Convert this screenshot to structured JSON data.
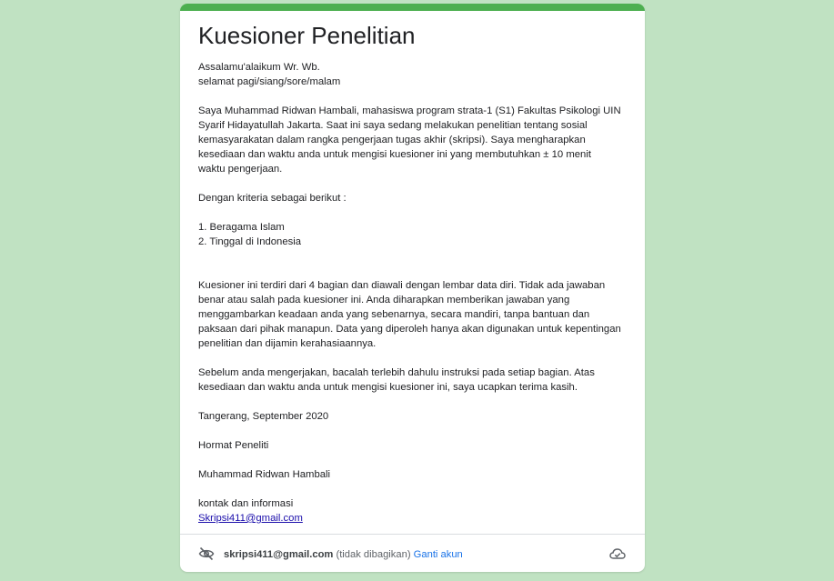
{
  "form": {
    "title": "Kuesioner Penelitian",
    "accent_color": "#4caf50",
    "background_color": "#c0e2c2",
    "description_lines": [
      "Assalamu'alaikum Wr. Wb.",
      "selamat pagi/siang/sore/malam",
      "",
      "Saya Muhammad Ridwan Hambali, mahasiswa program strata-1 (S1) Fakultas Psikologi UIN",
      "Syarif Hidayatullah Jakarta. Saat ini saya sedang melakukan penelitian tentang sosial",
      "kemasyarakatan dalam rangka pengerjaan tugas akhir (skripsi). Saya mengharapkan",
      "kesediaan dan waktu anda untuk mengisi kuesioner ini yang membutuhkan ± 10 menit",
      "waktu pengerjaan.",
      "",
      "Dengan kriteria sebagai berikut :",
      "",
      "1. Beragama Islam",
      "2. Tinggal di Indonesia",
      "",
      "",
      "Kuesioner ini terdiri dari 4 bagian dan diawali dengan lembar data diri. Tidak ada jawaban",
      "benar atau salah pada kuesioner ini. Anda diharapkan memberikan jawaban yang",
      "menggambarkan keadaan anda yang sebenarnya, secara mandiri, tanpa bantuan dan",
      "paksaan dari pihak manapun. Data yang diperoleh hanya akan digunakan untuk kepentingan",
      "penelitian dan dijamin kerahasiaannya.",
      "",
      "Sebelum anda mengerjakan, bacalah terlebih dahulu instruksi pada setiap bagian. Atas",
      "kesediaan dan waktu anda untuk mengisi kuesioner ini, saya ucapkan terima kasih.",
      "",
      "Tangerang, September 2020",
      "",
      "Hormat Peneliti",
      "",
      "Muhammad Ridwan Hambali",
      "",
      "kontak dan informasi"
    ],
    "contact_email": "Skripsi411@gmail.com"
  },
  "account": {
    "email": "skripsi411@gmail.com",
    "not_shared": "(tidak dibagikan)",
    "switch_label": "Ganti akun",
    "hide_icon": "eye-off-icon",
    "cloud_icon": "cloud-done-icon"
  }
}
